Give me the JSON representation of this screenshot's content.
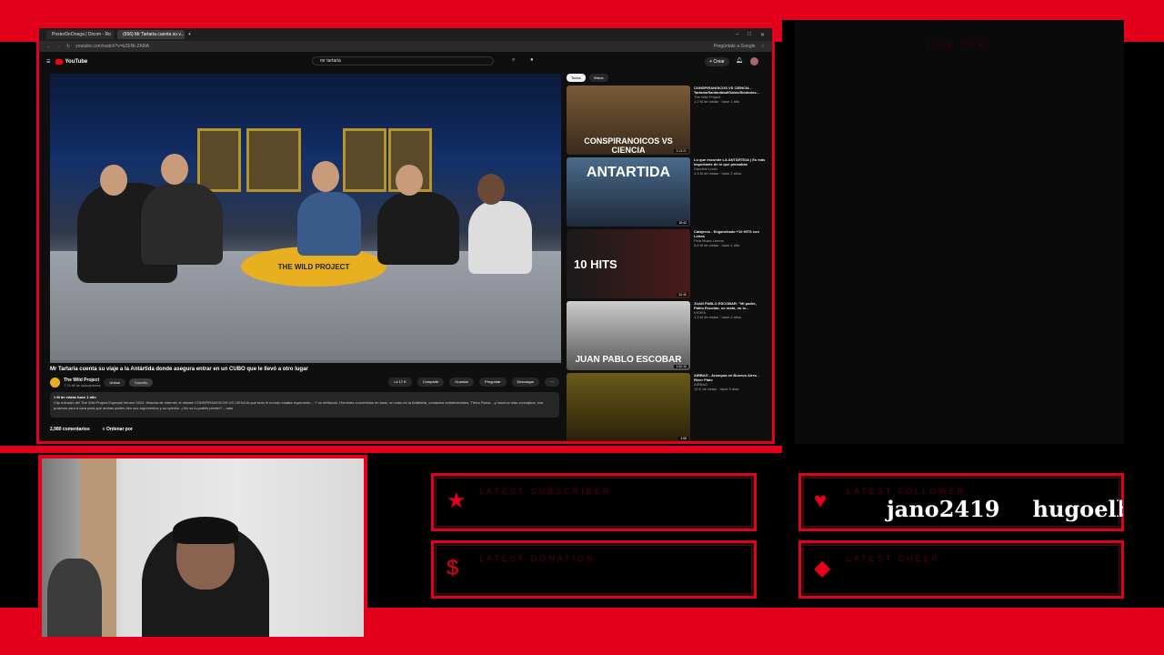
{
  "overlay": {
    "live_chat_title": "LIVE CHAT",
    "widgets": {
      "subscriber": {
        "label": "LATEST SUBSCRIBER",
        "icon": "★"
      },
      "donation": {
        "label": "LATEST DONATION",
        "icon": "$"
      },
      "follower": {
        "label": "LATEST FOLLOWER",
        "icon": "♥",
        "names": [
          "jano2419",
          "hugoelbart"
        ]
      },
      "cheer": {
        "label": "LATEST CHEER",
        "icon": "◆"
      }
    },
    "accent_color": "#e3001b"
  },
  "browser": {
    "tabs": [
      "PosterDeOnega | Dicom - Ro",
      "(656) Mr Tartaria cuenta su v..."
    ],
    "url": "youtube.com/watch?v=bZENt-ZA8iA",
    "profile_label": "Pregúntale a Google"
  },
  "youtube": {
    "logo": "YouTube",
    "search_query": "mr tartaria",
    "create_label": "Crear",
    "video_title": "Mr Tartaria cuenta su viaje a la Antártida donde asegura entrar en un CUBO que le llevó a otro lugar",
    "channel": {
      "name": "The Wild Project",
      "subs": "7,74 M de suscriptores",
      "join": "Unirse",
      "subscribe": "Suscrito"
    },
    "actions": [
      "17 K",
      "Compartir",
      "Guardar",
      "Preguntar",
      "Descargar"
    ],
    "description_stats": "1 M de vistas  hace 1 año",
    "description_text": "Clip extraído del The Wild Project Especial Verano 2024. Historia de internet; el debate CONSPIRANOICOS VS CIENCIA que todo el mundo estaba esperando... Y no defraudó. Hombres convertidos en lasio, un cubo en la Antártida, contactos extraterrestres, Tierra Plana... y muchos más conceptos, nos pusimos cara a cara para que ambas partes den sus argumentos y su opinión. ¿No os lo podéis perder? ...más",
    "comments_count": "2,980 comentarios",
    "sort_label": "Ordenar por",
    "chips": [
      "Todos",
      "Vistos"
    ],
    "recommendations": [
      {
        "title": "CONSPIRANOICOS VS CIENCIA - Tartaria/Santanidad/Gatos/Símbolos...",
        "channel": "The Wild Project",
        "meta": "1,2 M de vistas · hace 1 año",
        "thumb_text": "CONSPIRANOICOS VS CIENCIA",
        "duration": "2:13:21"
      },
      {
        "title": "Lo que esconde LA ANTÁRTIDA | Es más importante de lo que pensabas",
        "channel": "Dandelo Lucia",
        "meta": "4,3 M de vistas · hace 2 años",
        "thumb_text": "ANTARTIDA",
        "duration": "18:42"
      },
      {
        "title": "Calajeros - Enganchado +10 HITS con Letras",
        "channel": "Pela Music Lemon",
        "meta": "5,8 M de vistas · hace 1 año",
        "thumb_text": "10 HITS",
        "duration": "32:40"
      },
      {
        "title": "JUAN PABLO ESCOBAR: \"Mi padre, Pablo Escobar, no mató, no lo...",
        "channel": "VIGIFA",
        "meta": "1,3 M de vistas · hace 4 años",
        "thumb_text": "JUAN PABLO ESCOBAR",
        "duration": "1:52:10"
      },
      {
        "title": "AIRBAG - Anarquía en Buenos Aires - River Plate",
        "channel": "AIRBAG",
        "meta": "10 K de vistas · hace 9 días",
        "thumb_text": "",
        "duration": "3:58"
      }
    ]
  }
}
